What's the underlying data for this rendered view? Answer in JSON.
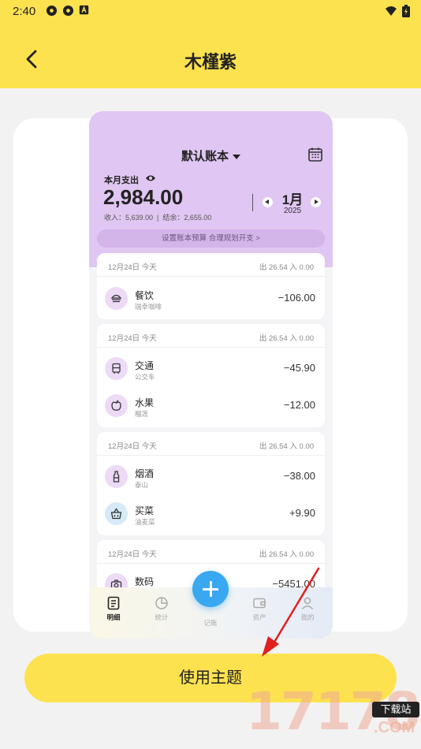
{
  "status_bar": {
    "time": "2:40"
  },
  "app_bar": {
    "title": "木槿紫"
  },
  "preview": {
    "book_name": "默认账本",
    "expense_label": "本月支出",
    "expense_amount": "2,984.00",
    "income_line": "收入：5,639.00",
    "balance_line": "结余：2,655.00",
    "month": "1月",
    "year": "2025",
    "budget_tip": "设置账本预算 合理规划开支 >",
    "groups": [
      {
        "date": "12月24日  今天",
        "totals": "出 26.54     入 0.00",
        "rows": [
          {
            "name": "餐饮",
            "sub": "瑞幸咖啡",
            "amount": "−106.00"
          }
        ]
      },
      {
        "date": "12月24日  今天",
        "totals": "出 26.54     入 0.00",
        "rows": [
          {
            "name": "交通",
            "sub": "公交车",
            "amount": "−45.90"
          },
          {
            "name": "水果",
            "sub": "榴莲",
            "amount": "−12.00"
          }
        ]
      },
      {
        "date": "12月24日  今天",
        "totals": "出 26.54     入 0.00",
        "rows": [
          {
            "name": "烟酒",
            "sub": "泰山",
            "amount": "−38.00"
          },
          {
            "name": "买菜",
            "sub": "油麦菜",
            "amount": "+9.90"
          }
        ]
      },
      {
        "date": "12月24日  今天",
        "totals": "出 26.54     入 0.00",
        "rows": [
          {
            "name": "数码",
            "sub": "",
            "amount": "−5451.00"
          }
        ]
      }
    ],
    "tabs": [
      {
        "label": "明细"
      },
      {
        "label": "统计"
      },
      {
        "label": "记账"
      },
      {
        "label": "资产"
      },
      {
        "label": "我的"
      }
    ]
  },
  "apply_button": {
    "label": "使用主题"
  },
  "watermark": {
    "number": "17178",
    "tag": "下载站",
    "suffix": ".COM"
  },
  "colors": {
    "accent_yellow": "#fde24f",
    "theme_purple": "#e0c6f2",
    "fab_blue": "#3aa8f0",
    "arrow_red": "#e02020"
  }
}
